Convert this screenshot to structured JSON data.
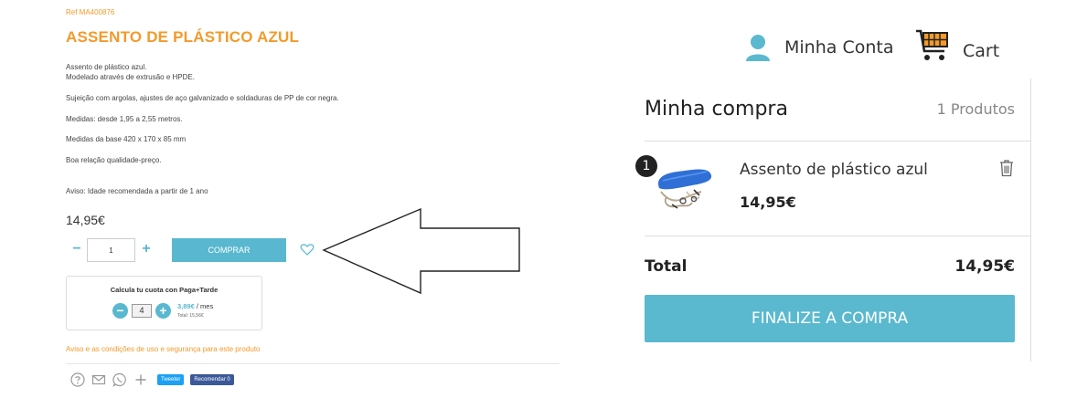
{
  "product": {
    "ref": "Ref MA400876",
    "title": "ASSENTO DE PLÁSTICO AZUL",
    "description": [
      "Assento de plástico azul.",
      "Modelado através de extrusão e HPDE.",
      "Sujeição com argolas, ajustes de aço galvanizado e soldaduras de PP de cor negra.",
      "Medidas: desde 1,95 a 2,55 metros.",
      "Medidas da base 420 x 170 x 85 mm",
      "Boa relação qualidade-preço.",
      "Aviso: Idade recomendada a partir de 1 ano"
    ],
    "price": "14,95€",
    "quantity_value": "1",
    "minus_symbol": "−",
    "plus_symbol": "+",
    "buy_label": "COMPRAR",
    "notice_link": "Aviso e as condições de uso e segurança para este produto"
  },
  "financing": {
    "title": "Calcula tu cuota con Paga+Tarde",
    "installments_value": "4",
    "minus_symbol": "−",
    "plus_symbol": "+",
    "monthly_amount": "3,89€",
    "monthly_suffix": " / mes",
    "total": "Total: 15,56€"
  },
  "share": {
    "twitter_label": "Tweeter",
    "facebook_label": "Recomendar 0"
  },
  "header": {
    "account_label": "Minha Conta",
    "cart_label": "Cart"
  },
  "cart_panel": {
    "title": "Minha compra",
    "count": "1 Produtos",
    "item": {
      "badge": "1",
      "name": "Assento de plástico azul",
      "price": "14,95€"
    },
    "total_label": "Total",
    "total_value": "14,95€",
    "checkout_label": "FINALIZE A COMPRA"
  },
  "colors": {
    "accent_orange": "#f39a2b",
    "accent_blue": "#59b8cf",
    "twitter": "#1da1f2",
    "facebook": "#3b5998"
  }
}
